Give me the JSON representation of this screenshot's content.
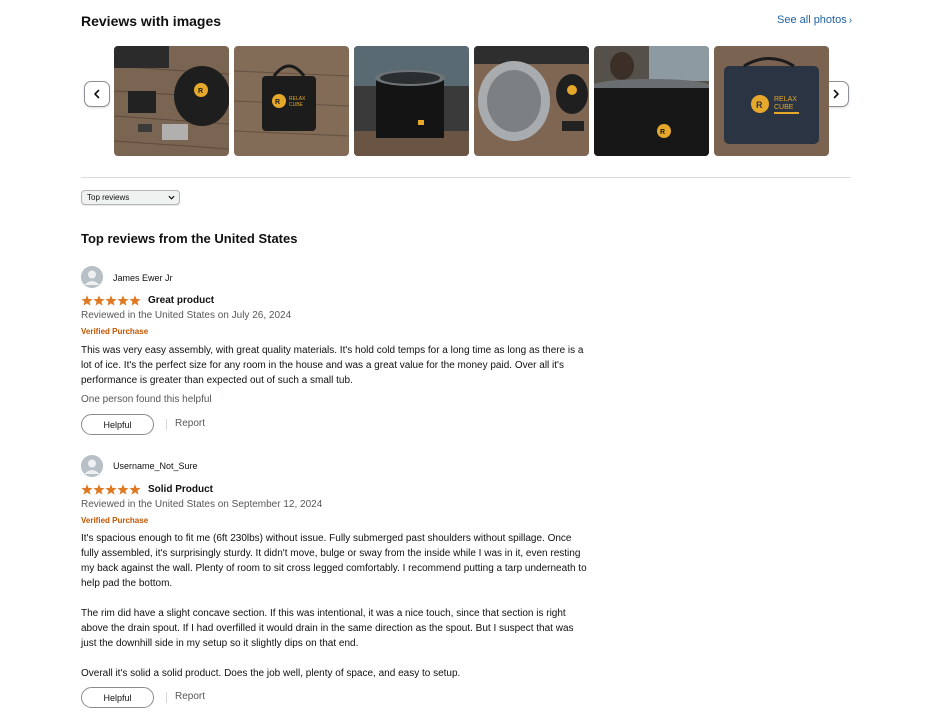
{
  "section": {
    "title": "Reviews with images",
    "see_all": "See all photos",
    "see_all_chevron": "›"
  },
  "thumbnails": [
    {
      "name": "thumb-1"
    },
    {
      "name": "thumb-2"
    },
    {
      "name": "thumb-3"
    },
    {
      "name": "thumb-4"
    },
    {
      "name": "thumb-5"
    },
    {
      "name": "thumb-6"
    }
  ],
  "brand": {
    "line1": "RELAX",
    "line2": "CUBE",
    "mark": "R"
  },
  "sort": {
    "selected": "Top reviews"
  },
  "list_title": "Top reviews from the United States",
  "colors": {
    "accent_link": "#2162a1",
    "star": "#de7921",
    "verified": "#c45500"
  },
  "reviews": [
    {
      "name": "James Ewer Jr",
      "rating": 5,
      "title": "Great product",
      "date": "Reviewed in the United States on July 26, 2024",
      "verified": "Verified Purchase",
      "body": [
        "This was very easy assembly, with great quality materials. It's hold cold temps for a long time as long as there is a lot of ice. It's the perfect size for any room in the house and was a great value for the money paid. Over all it's performance is greater than expected out of such a small tub."
      ],
      "helpful_count": "One person found this helpful",
      "helpful_label": "Helpful",
      "report_label": "Report"
    },
    {
      "name": "Username_Not_Sure",
      "rating": 5,
      "title": "Solid Product",
      "date": "Reviewed in the United States on September 12, 2024",
      "verified": "Verified Purchase",
      "body": [
        "It's spacious enough to fit me (6ft 230lbs) without issue. Fully submerged past shoulders without spillage. Once fully assembled, it's surprisingly sturdy. It didn't move, bulge or sway from the inside while I was in it, even resting my back against the wall. Plenty of room to sit cross legged comfortably. I recommend putting a tarp underneath to help pad the bottom.",
        "The rim did have a slight concave section. If this was intentional, it was a nice touch, since that section is right above the drain spout. If I had overfilled it would drain in the same direction as the spout. But I suspect that was just the downhill side in my setup so it slightly dips on that end.",
        "Overall it's solid a solid product. Does the job well, plenty of space, and easy to setup."
      ],
      "helpful_label": "Helpful",
      "report_label": "Report"
    }
  ]
}
